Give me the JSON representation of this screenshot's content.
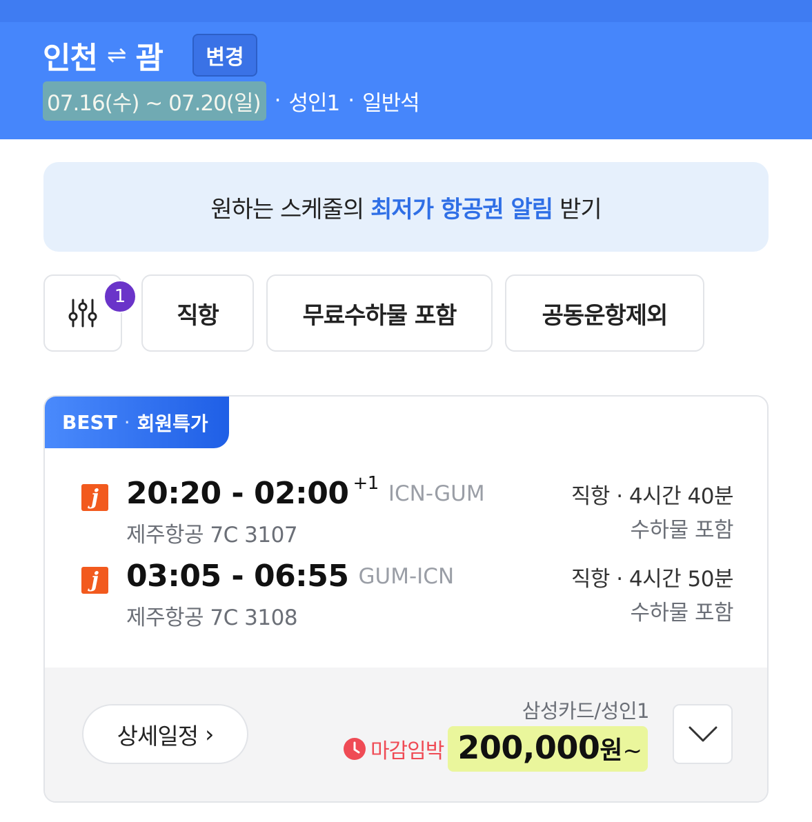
{
  "header": {
    "origin": "인천",
    "swap_symbol": "⇌",
    "destination": "괌",
    "change_label": "변경",
    "dates": "07.16(수) ~ 07.20(일)",
    "separator": "·",
    "passengers": "성인1",
    "cabin": "일반석",
    "colors": {
      "background": "#4686fb",
      "date_highlight": "#94c878"
    }
  },
  "banner": {
    "text_before": "원하는 스케줄의",
    "highlight": "최저가 항공권 알림",
    "text_after": "받기",
    "highlight_color": "#2f6fe6"
  },
  "filters": {
    "filter_icon": "sliders-icon",
    "active_count": "1",
    "chips": [
      "직항",
      "무료수하물 포함",
      "공동운항제외"
    ]
  },
  "result": {
    "tag": {
      "best": "BEST",
      "dot": "·",
      "label": "회원특가"
    },
    "legs": [
      {
        "airline_logo": "jejuair-logo",
        "logo_letter": "j",
        "times": "20:20 - 02:00",
        "day_offset": "+1",
        "route": "ICN-GUM",
        "flight": "제주항공 7C 3107",
        "info": "직항 · 4시간 40분",
        "baggage": "수하물 포함"
      },
      {
        "airline_logo": "jejuair-logo",
        "logo_letter": "j",
        "times": "03:05 - 06:55",
        "day_offset": "",
        "route": "GUM-ICN",
        "flight": "제주항공 7C 3108",
        "info": "직항 · 4시간 50분",
        "baggage": "수하물 포함"
      }
    ],
    "detail_button": "상세일정",
    "detail_chevron": "›",
    "card_label": "삼성카드/성인1",
    "deadline": "마감임박",
    "deadline_icon": "clock-icon",
    "price": "200,000",
    "currency": "원",
    "price_suffix": "~",
    "expand_icon": "chevron-down-icon",
    "colors": {
      "deadline": "#ef4b55",
      "price_highlight": "#e8f68c",
      "tag": "#2f6fe6"
    }
  }
}
